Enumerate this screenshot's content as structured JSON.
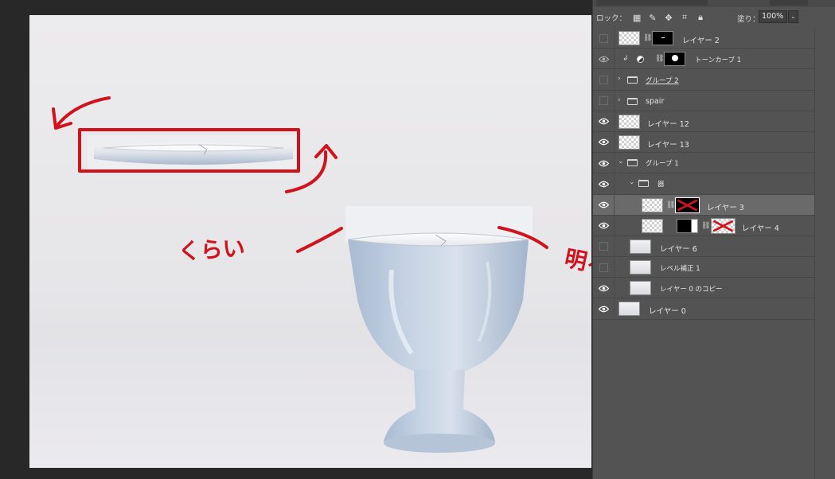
{
  "colors": {
    "canvas_bg": "#282828",
    "panel_bg": "#535353",
    "selected_row": "#6a6a6a",
    "annotation_red": "#d0121c",
    "cup_blue": "#b9c8dc"
  },
  "canvas": {
    "annotations": {
      "left_note": "くらい",
      "right_note": "明るい"
    }
  },
  "layers_panel": {
    "lock_label": "ロック：",
    "lock_icons": [
      "checker-lock-icon",
      "brush-lock-icon",
      "move-lock-icon",
      "artboard-lock-icon",
      "padlock-icon"
    ],
    "fill_label": "塗り：",
    "fill_value": "100%",
    "layers": [
      {
        "name": "レイヤー 2",
        "visible": false
      },
      {
        "name": "トーンカーブ 1",
        "visible": true
      },
      {
        "name": "グループ 2",
        "visible": false
      },
      {
        "name": "spair",
        "visible": false
      },
      {
        "name": "レイヤー 12",
        "visible": true
      },
      {
        "name": "レイヤー 13",
        "visible": true
      },
      {
        "name": "グループ 1",
        "visible": true
      },
      {
        "name": "器",
        "visible": true
      },
      {
        "name": "レイヤー 3",
        "visible": true,
        "selected": true
      },
      {
        "name": "レイヤー 4",
        "visible": true
      },
      {
        "name": "レイヤー 6",
        "visible": false
      },
      {
        "name": "レベル補正 1",
        "visible": false
      },
      {
        "name": "レイヤー 0 のコピー",
        "visible": true
      },
      {
        "name": "レイヤー 0",
        "visible": true
      }
    ]
  }
}
